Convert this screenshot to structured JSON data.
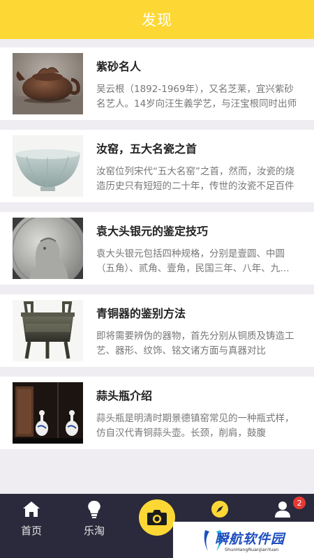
{
  "header": {
    "title": "发现"
  },
  "articles": [
    {
      "title": "紫砂名人",
      "desc": "吴云根（1892-1969年），又名芝莱，宜兴紫砂名艺人。14岁向汪生義学艺，与汪宝根同时出师",
      "image": "teapot-image"
    },
    {
      "title": "汝窑，五大名瓷之首",
      "desc": "汝窑位列宋代“五大名窑”之首，然而，汝瓷的烧造历史只有短短的二十年，传世的汝瓷不足百件",
      "image": "celadon-bowl-image"
    },
    {
      "title": "袁大头银元的鉴定技巧",
      "desc": "袁大头银元包括四种规格，分别是壹圆、中圆（五角）、贰角、壹角，民国三年、八年、九年、十年",
      "image": "silver-coin-image"
    },
    {
      "title": "青铜器的鉴别方法",
      "desc": "即将需要辨伪的器物，首先分别从铜质及铸造工艺、器形、纹饰、铭文诸方面与真器对比",
      "image": "bronze-ding-image"
    },
    {
      "title": "蒜头瓶介绍",
      "desc": "蒜头瓶是明清时期景德镇窑常见的一种瓶式样，仿自汉代青铜蒜头壶。长颈，削肩，鼓腹",
      "image": "garlic-vase-image"
    }
  ],
  "tabbar": {
    "home": "首页",
    "letao": "乐淘",
    "badge": "2"
  },
  "watermark": {
    "text": "瞬航软件园",
    "sub": "ShunHangRuanJianYuan"
  },
  "colors": {
    "accent": "#fdd835",
    "tabbar_bg": "#2a2a3c",
    "badge": "#e53935"
  }
}
